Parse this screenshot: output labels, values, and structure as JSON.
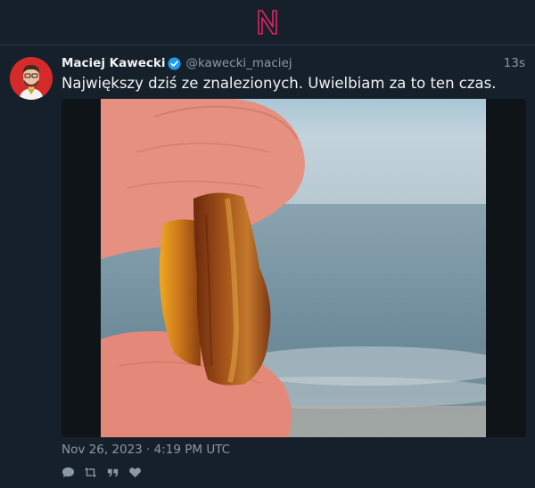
{
  "tweet": {
    "author_name": "Maciej Kawecki",
    "handle": "@kawecki_maciej",
    "relative_time": "13s",
    "text": "Największy dziś ze znalezionych. Uwielbiam za to ten czas.",
    "timestamp": "Nov 26, 2023 · 4:19 PM UTC"
  },
  "icons": {
    "logo": "n-logo-icon",
    "verified": "verified-badge-icon",
    "reply": "comment-icon",
    "retweet": "retweet-icon",
    "quote": "quote-icon",
    "like": "heart-icon"
  },
  "colors": {
    "background": "#15202b",
    "logo": "#e0245e",
    "verified": "#1d9bf0",
    "secondary_text": "#8b98a5"
  }
}
